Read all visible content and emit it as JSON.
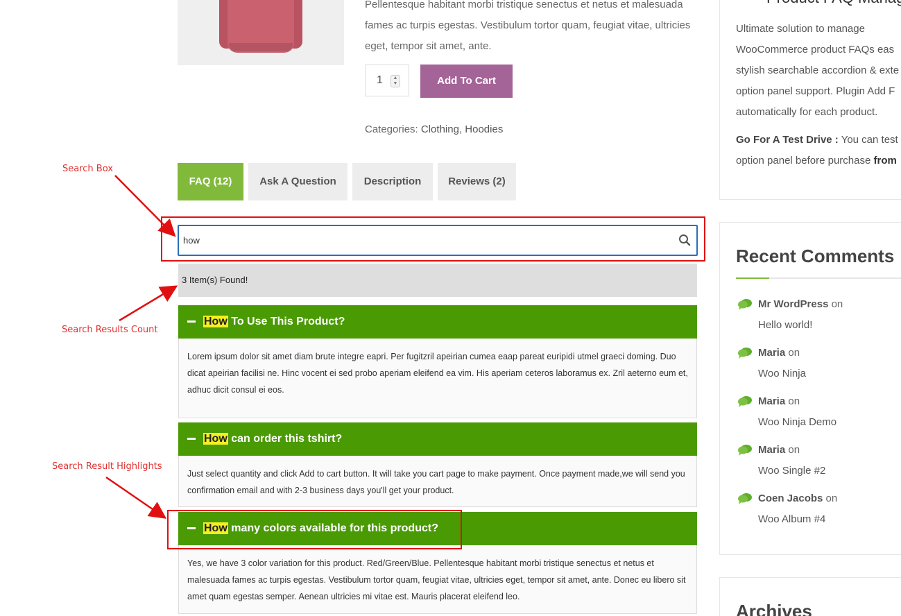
{
  "product": {
    "description": "Pellentesque habitant morbi tristique senectus et netus et malesuada fames ac turpis egestas. Vestibulum tortor quam, feugiat vitae, ultricies eget, tempor sit amet, ante.",
    "quantity": "1",
    "add_to_cart_label": "Add To Cart",
    "categories_label": "Categories:",
    "categories": [
      "Clothing",
      "Hoodies"
    ]
  },
  "tabs": [
    {
      "label": "FAQ (12)",
      "active": true
    },
    {
      "label": "Ask A Question",
      "active": false
    },
    {
      "label": "Description",
      "active": false
    },
    {
      "label": "Reviews (2)",
      "active": false
    }
  ],
  "search": {
    "value": "how"
  },
  "results_count": "3 Item(s) Found!",
  "faqs": [
    {
      "highlight": "How",
      "rest": " To Use This Product?",
      "answer": "Lorem ipsum dolor sit amet diam brute integre eapri. Per fugitzril apeirian cumea eaap pareat euripidi utmel graeci doming. Duo dicat apeirian facilisi ne. Hinc vocent ei sed probo aperiam eleifend ea vim. His aperiam ceteros laboramus ex. Zril aeterno eum et, adhuc dicit consul ei eos."
    },
    {
      "highlight": "How",
      "rest": " can order this tshirt?",
      "answer": "Just select quantity and click Add to cart button. It will take you cart page to make payment. Once payment made,we will send you confirmation email and with 2-3 business days you'll get your product."
    },
    {
      "highlight": "How",
      "rest": " many colors available for this product?",
      "answer": "Yes, we have 3 color variation for this product. Red/Green/Blue. Pellentesque habitant morbi tristique senectus et netus et malesuada fames ac turpis egestas. Vestibulum tortor quam, feugiat vitae, ultricies eget, tempor sit amet, ante. Donec eu libero sit amet quam egestas semper. Aenean ultricies mi vitae est. Mauris placerat eleifend leo."
    }
  ],
  "sidebar": {
    "top_heading": "Product FAQ Manag",
    "about_text": "Ultimate solution to manage WooCommerce product FAQs eas stylish searchable accordion & exte option panel support. Plugin Add F automatically for each product.",
    "test_drive_label": "Go For A Test Drive :",
    "test_drive_text": " You can test option panel before purchase ",
    "test_drive_from": "from",
    "recent_comments_title": "Recent Comments",
    "comments": [
      {
        "author": "Mr WordPress",
        "on": "on",
        "post": "Hello world!"
      },
      {
        "author": "Maria",
        "on": "on",
        "post": "Woo Ninja"
      },
      {
        "author": "Maria",
        "on": "on",
        "post": "Woo Ninja Demo"
      },
      {
        "author": "Maria",
        "on": "on",
        "post": "Woo Single #2"
      },
      {
        "author": "Coen Jacobs",
        "on": "on",
        "post": "Woo Album #4"
      }
    ],
    "archives_title": "Archives"
  },
  "annotations": {
    "search_box": "Search Box",
    "results_count": "Search Results Count",
    "highlights": "Search Result Highlights"
  },
  "colors": {
    "accent_green": "#81b93b",
    "faq_header_green": "#4a9a04",
    "add_to_cart_purple": "#a46497",
    "highlight_yellow": "#f4ef23",
    "annotation_red": "#e01010"
  }
}
